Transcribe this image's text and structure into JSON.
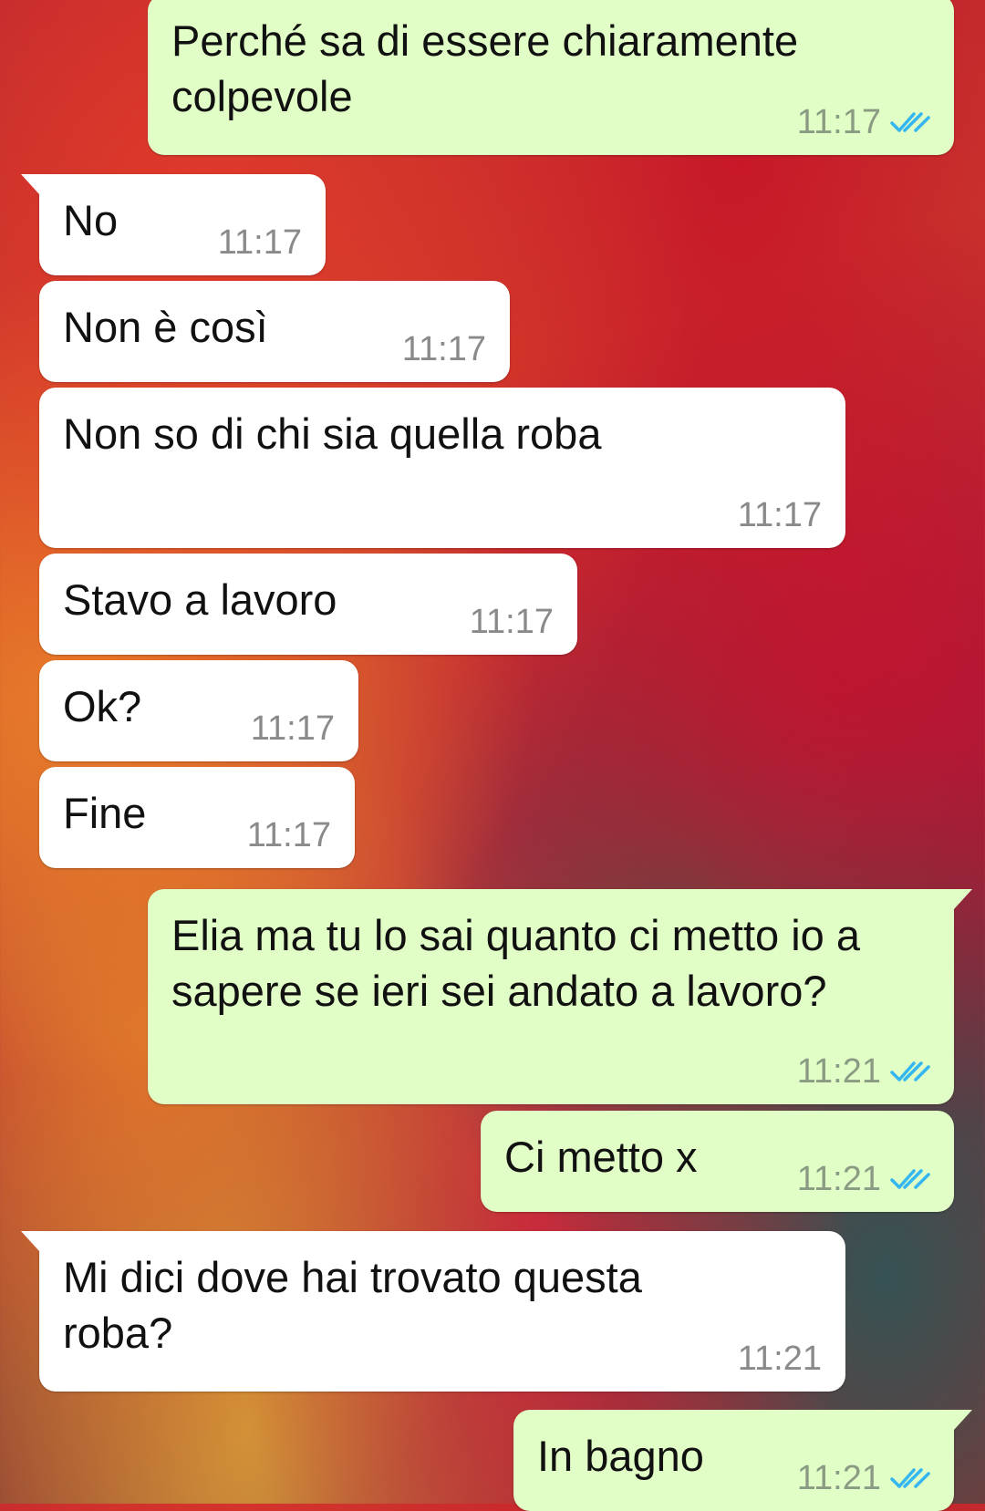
{
  "theme": {
    "incoming_bubble": "#ffffff",
    "outgoing_bubble": "#e1fec6",
    "read_tick_color": "#34b7f1"
  },
  "messages": [
    {
      "direction": "outgoing",
      "text": "Perché sa di essere chiaramente colpevole",
      "time": "11:17",
      "status": "read"
    },
    {
      "direction": "incoming",
      "text": "No",
      "time": "11:17"
    },
    {
      "direction": "incoming",
      "text": "Non è così",
      "time": "11:17"
    },
    {
      "direction": "incoming",
      "text": "Non so di chi sia quella roba",
      "time": "11:17"
    },
    {
      "direction": "incoming",
      "text": "Stavo a lavoro",
      "time": "11:17"
    },
    {
      "direction": "incoming",
      "text": "Ok?",
      "time": "11:17"
    },
    {
      "direction": "incoming",
      "text": "Fine",
      "time": "11:17"
    },
    {
      "direction": "outgoing",
      "text": "Elia ma tu lo sai quanto ci metto io a sapere se ieri sei andato a lavoro?",
      "time": "11:21",
      "status": "read"
    },
    {
      "direction": "outgoing",
      "text": "Ci metto x",
      "time": "11:21",
      "status": "read"
    },
    {
      "direction": "incoming",
      "text": "Mi dici dove hai trovato questa roba?",
      "time": "11:21"
    },
    {
      "direction": "outgoing",
      "text": "In bagno",
      "time": "11:21",
      "status": "read"
    }
  ]
}
